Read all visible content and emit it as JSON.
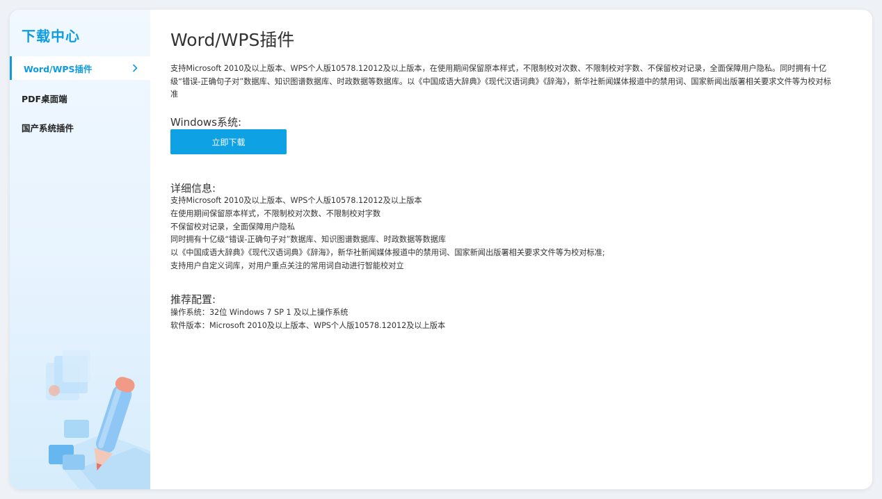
{
  "sidebar": {
    "title": "下载中心",
    "items": [
      {
        "label": "Word/WPS插件",
        "active": true
      },
      {
        "label": "PDF桌面端",
        "active": false
      },
      {
        "label": "国产系统插件",
        "active": false
      }
    ]
  },
  "main": {
    "title": "Word/WPS插件",
    "intro": "支持Microsoft 2010及以上版本、WPS个人版10578.12012及以上版本，在使用期间保留原本样式，不限制校对次数、不限制校对字数、不保留校对记录，全面保障用户隐私。同时拥有十亿级“错误-正确句子对”数据库、知识图谱数据库、时政数据等数据库。以《中国成语大辞典》《现代汉语词典》《辞海》，新华社新闻媒体报道中的禁用词、国家新闻出版署相关要求文件等为校对标准",
    "windows_heading": "Windows系统:",
    "download_button": "立即下载",
    "details_heading": "详细信息:",
    "details": [
      "支持Microsoft 2010及以上版本、WPS个人版10578.12012及以上版本",
      "在使用期间保留原本样式，不限制校对次数、不限制校对字数",
      "不保留校对记录，全面保障用户隐私",
      "同时拥有十亿级“错误-正确句子对”数据库、知识图谱数据库、时政数据等数据库",
      "以《中国成语大辞典》《现代汉语词典》《辞海》，新华社新闻媒体报道中的禁用词、国家新闻出版署相关要求文件等为校对标准;",
      "支持用户自定义词库，对用户重点关注的常用词自动进行智能校对立"
    ],
    "config_heading": "推荐配置:",
    "config": [
      "操作系统：32位 Windows 7 SP 1 及以上操作系统",
      "软件版本：Microsoft 2010及以上版本、WPS个人版10578.12012及以上版本"
    ]
  },
  "colors": {
    "accent": "#0ea1e3",
    "title_accent": "#0e9be0",
    "sidebar_bg": "#e9f5fe"
  },
  "icons": {
    "chevron": "chevron-right-icon"
  }
}
